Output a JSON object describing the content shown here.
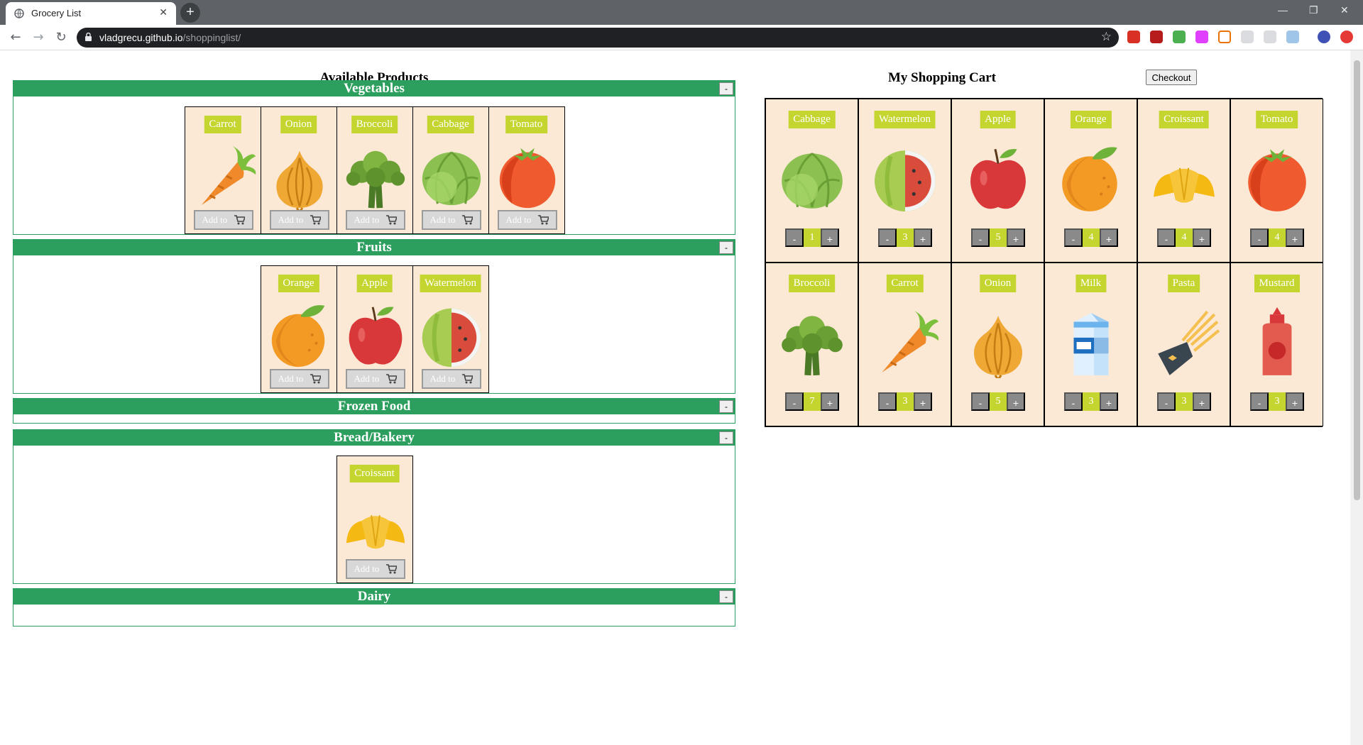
{
  "browser": {
    "tab_title": "Grocery List",
    "url_host": "vladgrecu.github.io",
    "url_path": "/shoppinglist/"
  },
  "headings": {
    "available": "Available Products",
    "cart": "My Shopping Cart"
  },
  "checkout_label": "Checkout",
  "collapse_label": "-",
  "add_label": "Add to",
  "categories": [
    {
      "name": "Vegetables",
      "products": [
        "Carrot",
        "Onion",
        "Broccoli",
        "Cabbage",
        "Tomato"
      ]
    },
    {
      "name": "Fruits",
      "products": [
        "Orange",
        "Apple",
        "Watermelon"
      ]
    },
    {
      "name": "Frozen Food",
      "products": []
    },
    {
      "name": "Bread/Bakery",
      "products": [
        "Croissant"
      ]
    },
    {
      "name": "Dairy",
      "products": []
    }
  ],
  "cart": [
    {
      "name": "Cabbage",
      "qty": "1"
    },
    {
      "name": "Watermelon",
      "qty": "3"
    },
    {
      "name": "Apple",
      "qty": "5"
    },
    {
      "name": "Orange",
      "qty": "4"
    },
    {
      "name": "Croissant",
      "qty": "4"
    },
    {
      "name": "Tomato",
      "qty": "4"
    },
    {
      "name": "Broccoli",
      "qty": "7"
    },
    {
      "name": "Carrot",
      "qty": "3"
    },
    {
      "name": "Onion",
      "qty": "5"
    },
    {
      "name": "Milk",
      "qty": "3"
    },
    {
      "name": "Pasta",
      "qty": "3"
    },
    {
      "name": "Mustard",
      "qty": "3"
    }
  ],
  "qty_minus": "-",
  "qty_plus": "+",
  "colors": {
    "category_green": "#2c9e5d",
    "label_lime": "#c5d530",
    "card_bg": "#fbe9d6"
  }
}
